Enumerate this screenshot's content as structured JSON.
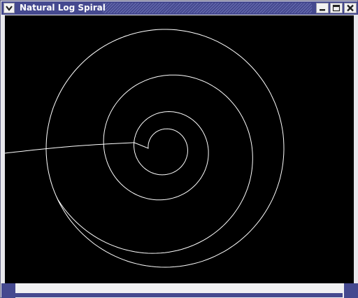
{
  "window": {
    "title": "Natural Log Spiral"
  },
  "colors": {
    "titlebar": "#45498f",
    "canvas_background": "#000000",
    "curve": "#ffffff"
  },
  "icons": {
    "window_menu": "chevron-down-icon",
    "minimize": "minimize-icon",
    "maximize": "maximize-icon",
    "close": "close-icon"
  },
  "drawing": {
    "shape": "logarithmic spiral"
  }
}
